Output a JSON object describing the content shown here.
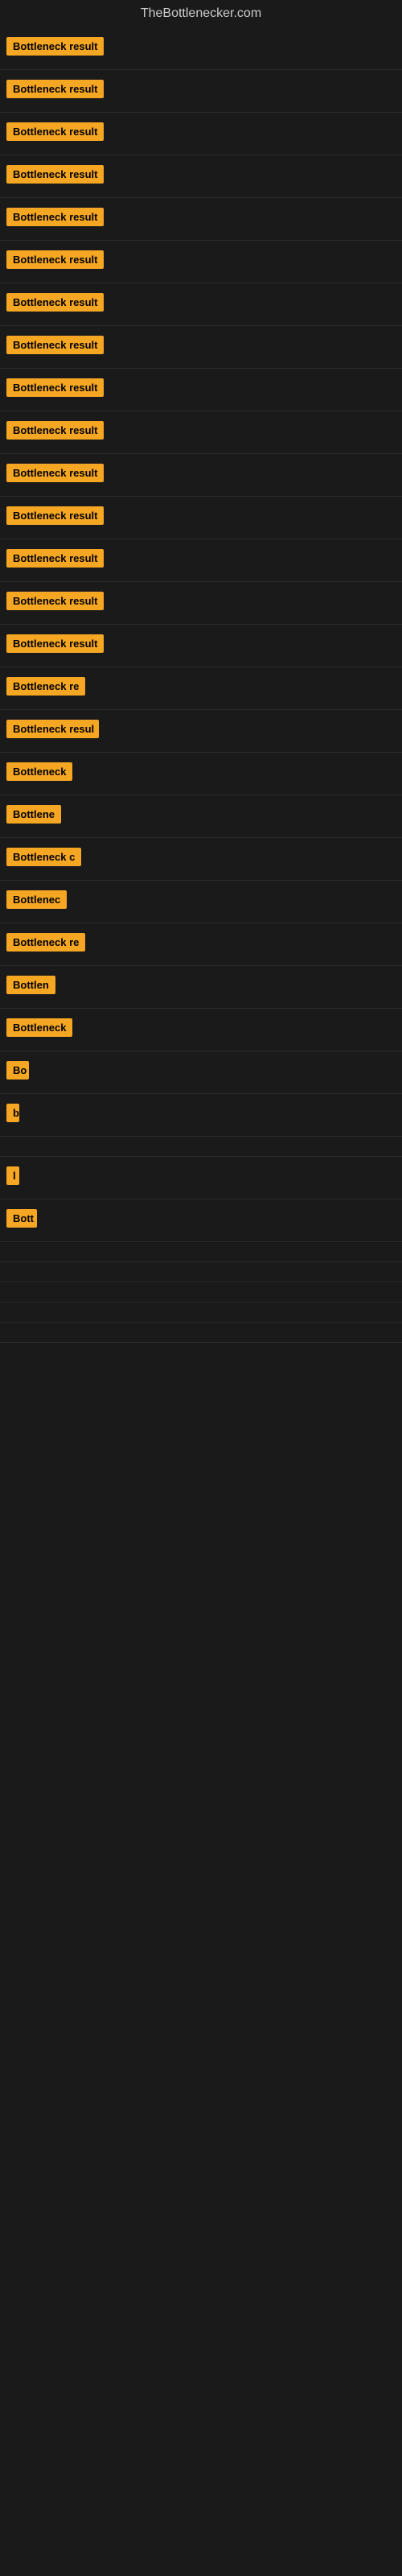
{
  "site": {
    "title": "TheBottlenecker.com"
  },
  "rows": [
    {
      "id": 1,
      "label": "Bottleneck result",
      "width": 130
    },
    {
      "id": 2,
      "label": "Bottleneck result",
      "width": 130
    },
    {
      "id": 3,
      "label": "Bottleneck result",
      "width": 130
    },
    {
      "id": 4,
      "label": "Bottleneck result",
      "width": 130
    },
    {
      "id": 5,
      "label": "Bottleneck result",
      "width": 130
    },
    {
      "id": 6,
      "label": "Bottleneck result",
      "width": 130
    },
    {
      "id": 7,
      "label": "Bottleneck result",
      "width": 130
    },
    {
      "id": 8,
      "label": "Bottleneck result",
      "width": 130
    },
    {
      "id": 9,
      "label": "Bottleneck result",
      "width": 130
    },
    {
      "id": 10,
      "label": "Bottleneck result",
      "width": 130
    },
    {
      "id": 11,
      "label": "Bottleneck result",
      "width": 130
    },
    {
      "id": 12,
      "label": "Bottleneck result",
      "width": 130
    },
    {
      "id": 13,
      "label": "Bottleneck result",
      "width": 130
    },
    {
      "id": 14,
      "label": "Bottleneck result",
      "width": 130
    },
    {
      "id": 15,
      "label": "Bottleneck result",
      "width": 130
    },
    {
      "id": 16,
      "label": "Bottleneck re",
      "width": 105
    },
    {
      "id": 17,
      "label": "Bottleneck resul",
      "width": 115
    },
    {
      "id": 18,
      "label": "Bottleneck",
      "width": 85
    },
    {
      "id": 19,
      "label": "Bottlene",
      "width": 72
    },
    {
      "id": 20,
      "label": "Bottleneck c",
      "width": 95
    },
    {
      "id": 21,
      "label": "Bottlenec",
      "width": 78
    },
    {
      "id": 22,
      "label": "Bottleneck re",
      "width": 105
    },
    {
      "id": 23,
      "label": "Bottlen",
      "width": 65
    },
    {
      "id": 24,
      "label": "Bottleneck",
      "width": 85
    },
    {
      "id": 25,
      "label": "Bo",
      "width": 28
    },
    {
      "id": 26,
      "label": "b",
      "width": 14
    },
    {
      "id": 27,
      "label": "",
      "width": 8
    },
    {
      "id": 28,
      "label": "l",
      "width": 8
    },
    {
      "id": 29,
      "label": "Bott",
      "width": 38
    },
    {
      "id": 30,
      "label": "",
      "width": 0
    },
    {
      "id": 31,
      "label": "",
      "width": 0
    },
    {
      "id": 32,
      "label": "",
      "width": 0
    },
    {
      "id": 33,
      "label": "",
      "width": 0
    },
    {
      "id": 34,
      "label": "",
      "width": 0
    }
  ]
}
